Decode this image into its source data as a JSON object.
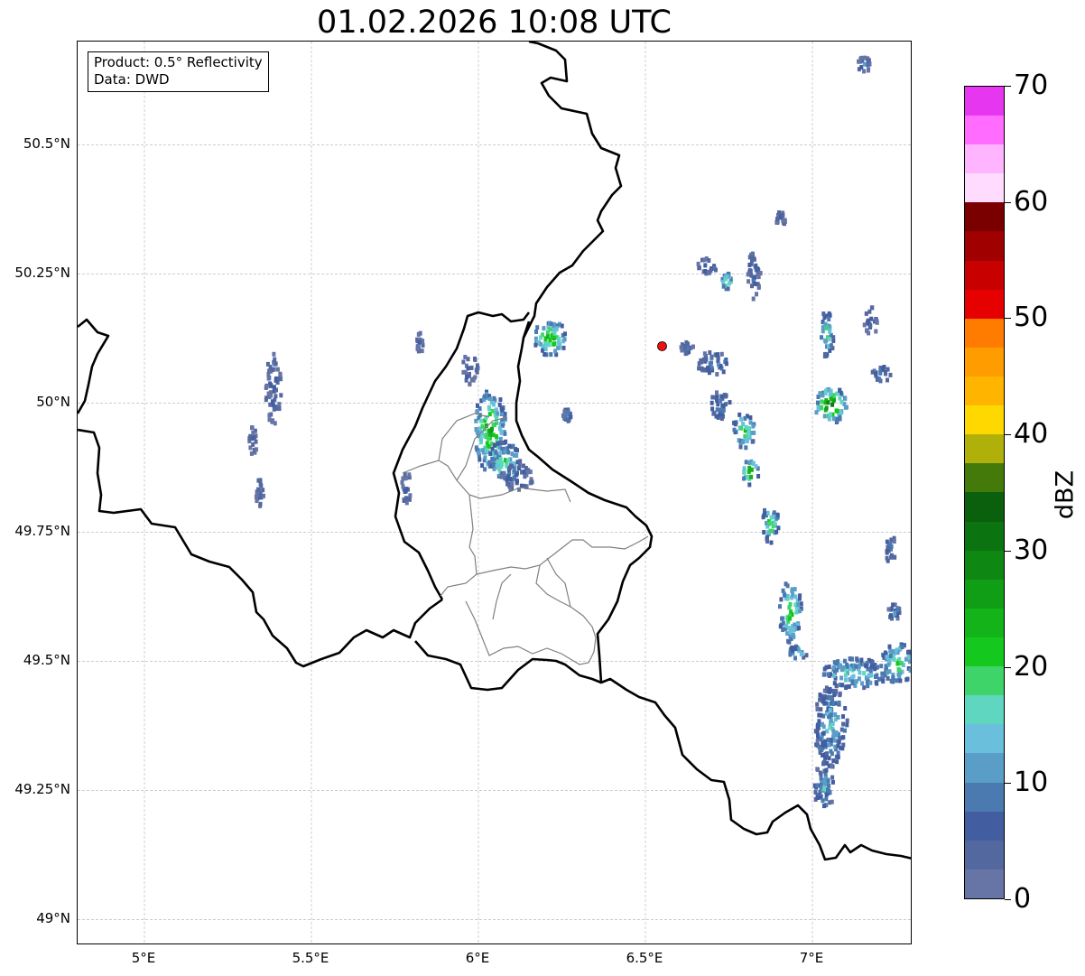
{
  "title": "01.02.2026 10:08 UTC",
  "info": {
    "product_line": "Product: 0.5° Reflectivity",
    "data_line": "Data: DWD"
  },
  "map": {
    "lon_range": [
      4.8,
      7.3
    ],
    "lat_range": [
      48.95,
      50.7
    ],
    "lat_ticks": [
      {
        "value": 50.5,
        "label": "50.5°N"
      },
      {
        "value": 50.25,
        "label": "50.25°N"
      },
      {
        "value": 50.0,
        "label": "50°N"
      },
      {
        "value": 49.75,
        "label": "49.75°N"
      },
      {
        "value": 49.5,
        "label": "49.5°N"
      },
      {
        "value": 49.25,
        "label": "49.25°N"
      },
      {
        "value": 49.0,
        "label": "49°N"
      }
    ],
    "lon_ticks": [
      {
        "value": 5.0,
        "label": "5°E"
      },
      {
        "value": 5.5,
        "label": "5.5°E"
      },
      {
        "value": 6.0,
        "label": "6°E"
      },
      {
        "value": 6.5,
        "label": "6.5°E"
      },
      {
        "value": 7.0,
        "label": "7°E"
      }
    ],
    "radar_site": {
      "lon": 6.55,
      "lat": 50.11,
      "color": "#ee1111"
    },
    "gridlines": true
  },
  "colorbar": {
    "label": "dBZ",
    "min": 0,
    "max": 70,
    "step": 2.5,
    "ticks": [
      "0",
      "10",
      "20",
      "30",
      "40",
      "50",
      "60",
      "70"
    ],
    "colors": [
      "#6674a6",
      "#5468a0",
      "#425ea0",
      "#4a7ab0",
      "#5a9ec8",
      "#6ac0dc",
      "#5fd6c0",
      "#3ed46a",
      "#14c81e",
      "#12b41a",
      "#109e16",
      "#0e8812",
      "#0b7410",
      "#0a600c",
      "#447a0a",
      "#b0b00a",
      "#ffd800",
      "#ffb400",
      "#ff9c00",
      "#ff7c00",
      "#e60000",
      "#c80000",
      "#a00000",
      "#7a0000",
      "#ffdcff",
      "#ffb4ff",
      "#ff6cff",
      "#e636f0"
    ]
  },
  "echo_cells": [
    {
      "lon": 5.38,
      "lat": 50.03,
      "rlon": 0.025,
      "rlat": 0.07,
      "dbz": 6
    },
    {
      "lon": 5.32,
      "lat": 49.93,
      "rlon": 0.012,
      "rlat": 0.03,
      "dbz": 5
    },
    {
      "lon": 5.34,
      "lat": 49.83,
      "rlon": 0.012,
      "rlat": 0.03,
      "dbz": 5
    },
    {
      "lon": 5.82,
      "lat": 50.12,
      "rlon": 0.01,
      "rlat": 0.02,
      "dbz": 5
    },
    {
      "lon": 5.97,
      "lat": 50.07,
      "rlon": 0.025,
      "rlat": 0.03,
      "dbz": 6
    },
    {
      "lon": 6.03,
      "lat": 49.95,
      "rlon": 0.05,
      "rlat": 0.08,
      "dbz": 26
    },
    {
      "lon": 6.07,
      "lat": 49.89,
      "rlon": 0.05,
      "rlat": 0.04,
      "dbz": 20
    },
    {
      "lon": 6.11,
      "lat": 49.86,
      "rlon": 0.05,
      "rlat": 0.025,
      "dbz": 8
    },
    {
      "lon": 5.78,
      "lat": 49.84,
      "rlon": 0.015,
      "rlat": 0.03,
      "dbz": 6
    },
    {
      "lon": 6.21,
      "lat": 50.13,
      "rlon": 0.05,
      "rlat": 0.035,
      "dbz": 26
    },
    {
      "lon": 6.26,
      "lat": 49.98,
      "rlon": 0.012,
      "rlat": 0.012,
      "dbz": 14
    },
    {
      "lon": 6.62,
      "lat": 50.11,
      "rlon": 0.02,
      "rlat": 0.012,
      "dbz": 8
    },
    {
      "lon": 6.7,
      "lat": 50.08,
      "rlon": 0.05,
      "rlat": 0.025,
      "dbz": 10
    },
    {
      "lon": 6.68,
      "lat": 50.27,
      "rlon": 0.03,
      "rlat": 0.015,
      "dbz": 8
    },
    {
      "lon": 6.74,
      "lat": 50.24,
      "rlon": 0.015,
      "rlat": 0.015,
      "dbz": 26
    },
    {
      "lon": 6.82,
      "lat": 50.25,
      "rlon": 0.02,
      "rlat": 0.05,
      "dbz": 8
    },
    {
      "lon": 6.72,
      "lat": 50.0,
      "rlon": 0.03,
      "rlat": 0.03,
      "dbz": 10
    },
    {
      "lon": 6.79,
      "lat": 49.95,
      "rlon": 0.035,
      "rlat": 0.035,
      "dbz": 22
    },
    {
      "lon": 6.81,
      "lat": 49.87,
      "rlon": 0.025,
      "rlat": 0.025,
      "dbz": 30
    },
    {
      "lon": 6.87,
      "lat": 49.77,
      "rlon": 0.025,
      "rlat": 0.04,
      "dbz": 22
    },
    {
      "lon": 6.93,
      "lat": 49.6,
      "rlon": 0.035,
      "rlat": 0.06,
      "dbz": 24
    },
    {
      "lon": 6.95,
      "lat": 49.52,
      "rlon": 0.03,
      "rlat": 0.015,
      "dbz": 15
    },
    {
      "lon": 6.9,
      "lat": 50.36,
      "rlon": 0.015,
      "rlat": 0.015,
      "dbz": 8
    },
    {
      "lon": 7.05,
      "lat": 50.0,
      "rlon": 0.05,
      "rlat": 0.035,
      "dbz": 30
    },
    {
      "lon": 7.04,
      "lat": 50.14,
      "rlon": 0.02,
      "rlat": 0.05,
      "dbz": 20
    },
    {
      "lon": 7.17,
      "lat": 50.16,
      "rlon": 0.02,
      "rlat": 0.03,
      "dbz": 7
    },
    {
      "lon": 7.2,
      "lat": 50.06,
      "rlon": 0.03,
      "rlat": 0.015,
      "dbz": 10
    },
    {
      "lon": 7.12,
      "lat": 49.48,
      "rlon": 0.1,
      "rlat": 0.03,
      "dbz": 18
    },
    {
      "lon": 7.25,
      "lat": 49.5,
      "rlon": 0.05,
      "rlat": 0.04,
      "dbz": 22
    },
    {
      "lon": 7.05,
      "lat": 49.38,
      "rlon": 0.05,
      "rlat": 0.08,
      "dbz": 14
    },
    {
      "lon": 7.03,
      "lat": 49.26,
      "rlon": 0.03,
      "rlat": 0.05,
      "dbz": 13
    },
    {
      "lon": 7.15,
      "lat": 50.66,
      "rlon": 0.02,
      "rlat": 0.015,
      "dbz": 8
    },
    {
      "lon": 7.23,
      "lat": 49.72,
      "rlon": 0.015,
      "rlat": 0.03,
      "dbz": 9
    },
    {
      "lon": 7.24,
      "lat": 49.6,
      "rlon": 0.02,
      "rlat": 0.015,
      "dbz": 10
    }
  ]
}
